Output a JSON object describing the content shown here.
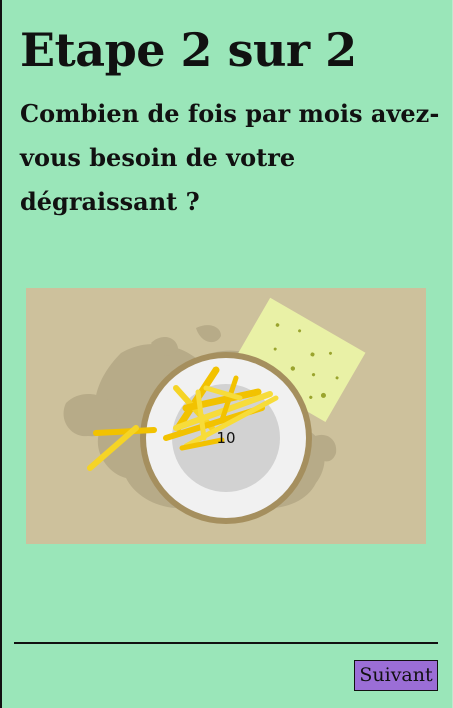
{
  "header": {
    "step_title": "Etape 2 sur 2"
  },
  "question": {
    "text": "Combien de fois par mois avez-vous besoin de votre dégraissant ?"
  },
  "slider": {
    "value": "10"
  },
  "footer": {
    "next_label": "Suivant"
  },
  "colors": {
    "background": "#9ae6b9",
    "illustration_bg": "#cdc19c",
    "button": "#9b6ed6"
  },
  "icons": {
    "illustration": "fries-plate-illustration"
  }
}
